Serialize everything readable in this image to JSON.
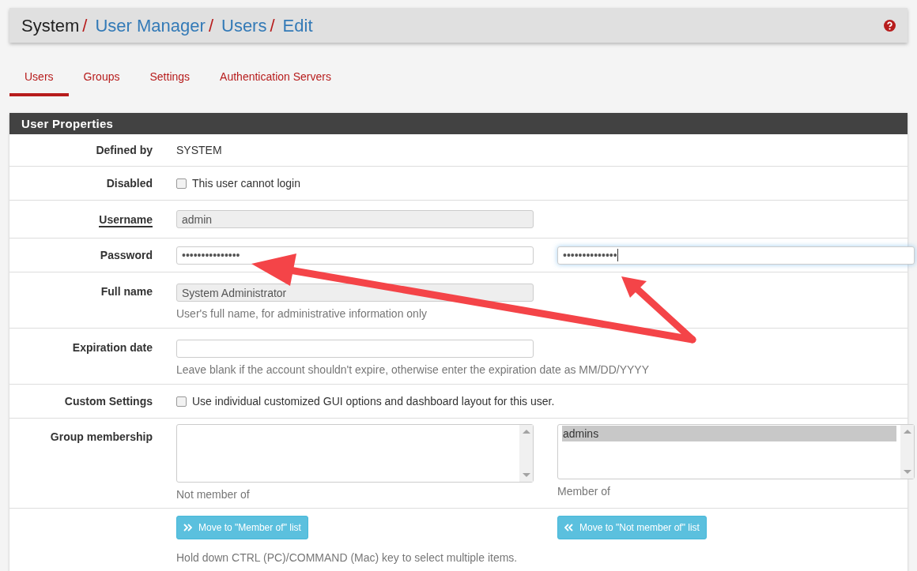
{
  "breadcrumb": [
    {
      "text": "System",
      "link": false,
      "separator": "/"
    },
    {
      "text": "User Manager",
      "link": true,
      "separator": "/"
    },
    {
      "text": "Users",
      "link": true,
      "separator": "/"
    },
    {
      "text": "Edit",
      "link": true
    }
  ],
  "tabs": [
    {
      "label": "Users",
      "selected": true
    },
    {
      "label": "Groups",
      "selected": false
    },
    {
      "label": "Settings",
      "selected": false
    },
    {
      "label": "Authentication Servers",
      "selected": false
    }
  ],
  "panel": {
    "title": "User Properties",
    "rows": [
      {
        "kind": "text",
        "label": "Defined by",
        "value": "SYSTEM"
      },
      {
        "kind": "checkbox",
        "label": "Disabled",
        "checked": false,
        "text": "This user cannot login"
      },
      {
        "kind": "input",
        "label": "Username",
        "underlined": true,
        "value": "admin",
        "disabled": true
      },
      {
        "kind": "password",
        "label": "Password",
        "fields": [
          {
            "value": "•••••••••••••••",
            "focused": false
          },
          {
            "value": "••••••••••••••",
            "focused": true
          }
        ]
      },
      {
        "kind": "input",
        "label": "Full name",
        "value": "System Administrator",
        "disabled": true,
        "help": "User's full name, for administrative information only"
      },
      {
        "kind": "input",
        "label": "Expiration date",
        "disabled": false,
        "help": "Leave blank if the account shouldn't expire, otherwise enter the expiration date as MM/DD/YYYY"
      },
      {
        "kind": "checkbox",
        "label": "Custom Settings",
        "checked": false,
        "text": "Use individual customized GUI options and dashboard layout for this user."
      },
      {
        "kind": "lists",
        "label": "Group membership",
        "lists": [
          {
            "caption": "Not member of"
          },
          {
            "caption": "Member of",
            "items": [
              {
                "text": "admins",
                "selected": true
              }
            ]
          }
        ]
      },
      {
        "kind": "buttons",
        "buttons": [
          {
            "label": "Move to \"Member of\" list",
            "kind": "add"
          },
          {
            "label": "Move to \"Not member of\" list",
            "kind": "remove"
          }
        ],
        "help": "Hold down CTRL (PC)/COMMAND (Mac) key to select multiple items."
      }
    ]
  }
}
